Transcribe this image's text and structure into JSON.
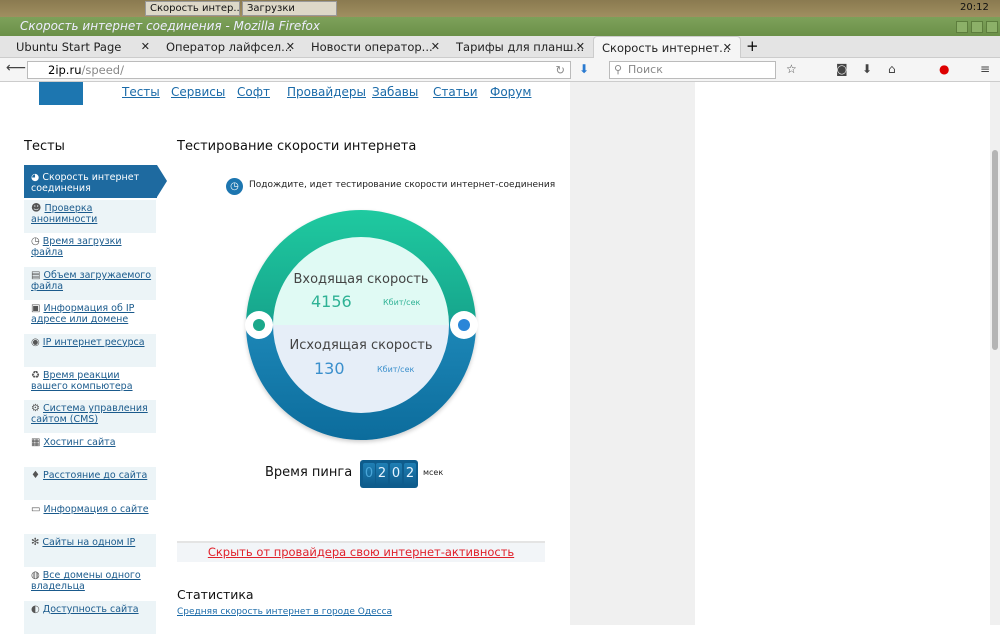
{
  "taskbar": {
    "windows": [
      "Скорость интер...",
      "Загрузки"
    ],
    "clock": "20:12"
  },
  "window_title": "Скорость интернет соединения - Mozilla Firefox",
  "tabs": [
    {
      "label": "Ubuntu Start Page"
    },
    {
      "label": "Оператор лайфсел..."
    },
    {
      "label": "Новости оператор..."
    },
    {
      "label": "Тарифы для планш..."
    },
    {
      "label": "Скорость интернет..."
    }
  ],
  "url": {
    "host": "2ip.ru",
    "path": "/speed/"
  },
  "search_placeholder": "Поиск",
  "topnav": [
    "Тесты",
    "Сервисы",
    "Софт",
    "Провайдеры",
    "Забавы",
    "Статьи",
    "Форум"
  ],
  "sidebar": {
    "title": "Тесты",
    "active": "Скорость интернет соединения",
    "items": [
      "Проверка анонимности",
      "Время загрузки файла",
      "Объем загружаемого файла",
      "Информация об IP адресе или домене",
      "IP интернет ресурса",
      "Время реакции вашего компьютера",
      "Система управления сайтом (CMS)",
      "Хостинг сайта",
      "Расстояние до сайта",
      "Информация о сайте",
      "Сайты на одном IP",
      "Все домены одного владельца",
      "Доступность сайта"
    ]
  },
  "main": {
    "title": "Тестирование скорости интернета",
    "status": "Подождите, идет тестирование скорости интернет-соединения",
    "download": {
      "label": "Входящая скорость",
      "value": "4156",
      "unit": "Кбит/сек"
    },
    "upload": {
      "label": "Исходящая скорость",
      "value": "130",
      "unit": "Кбит/сек"
    },
    "ping": {
      "label": "Время пинга",
      "digits": [
        "0",
        "2",
        "0",
        "2"
      ],
      "unit": "мсек"
    },
    "hide_link": "Скрыть от провайдера свою интернет-активность",
    "stats_title": "Статистика",
    "stats_link": "Средняя скорость интернет в городе Одесса"
  },
  "colors": {
    "teal": "#1fcaa0",
    "blue": "#1c86b6",
    "link": "#1a6aa8",
    "red": "#e0202a"
  }
}
